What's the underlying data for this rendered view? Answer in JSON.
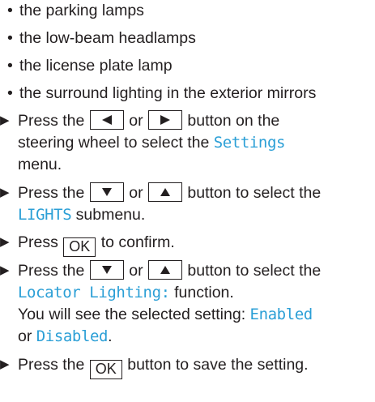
{
  "bullets": [
    "the parking lamps",
    "the low-beam headlamps",
    "the license plate lamp",
    "the surround lighting in the exterior mirrors"
  ],
  "steps": {
    "s1": {
      "t1": "Press the",
      "or": "or",
      "t2": "button on the",
      "t3": "steering wheel to select the",
      "menu": "Settings",
      "t4": "menu."
    },
    "s2": {
      "t1": "Press the",
      "or": "or",
      "t2": "button to select the",
      "menu": "LIGHTS",
      "t3": "submenu."
    },
    "s3": {
      "t1": "Press",
      "key": "OK",
      "t2": "to confirm."
    },
    "s4": {
      "t1": "Press the",
      "or": "or",
      "t2": "button to select the",
      "func": "Locator Lighting:",
      "t3": "function.",
      "t4": "You will see the selected setting:",
      "opt1": "Enabled",
      "or2": "or",
      "opt2": "Disabled",
      "t5": "."
    },
    "s5": {
      "t1": "Press the",
      "key": "OK",
      "t2": "button to save the setting."
    }
  },
  "icons": {
    "bullet": "•",
    "step_arrow": "▶",
    "left_key": "left-triangle-icon",
    "right_key": "right-triangle-icon",
    "down_key": "down-triangle-icon",
    "up_key": "up-triangle-icon"
  },
  "colors": {
    "text": "#231f20",
    "display_text": "#2b9fd6"
  }
}
